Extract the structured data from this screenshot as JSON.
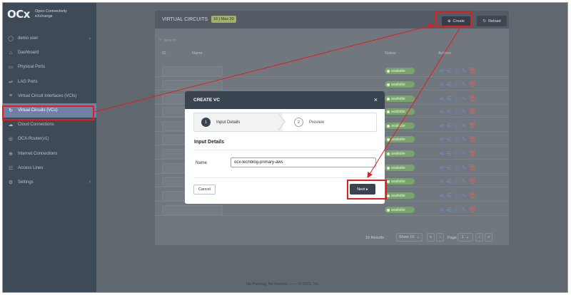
{
  "brand": {
    "logo": "OCx",
    "line1": "Open Connectivity",
    "line2": "eXchange"
  },
  "sidebar": {
    "items": [
      {
        "label": "demo user",
        "icon": "user-icon",
        "chevron": "›"
      },
      {
        "label": "Dashboard",
        "icon": "home-icon"
      },
      {
        "label": "Physical Ports",
        "icon": "port-icon"
      },
      {
        "label": "LAG Ports",
        "icon": "lag-icon"
      },
      {
        "label": "Virtual Circuit Interfaces (VCIs)",
        "icon": "sliders-icon"
      },
      {
        "label": "Virtual Circuits (VCs)",
        "icon": "circuit-icon"
      },
      {
        "label": "Cloud Connections",
        "icon": "cloud-icon"
      },
      {
        "label": "OCX-Router(v1)",
        "icon": "router-icon"
      },
      {
        "label": "Internet Connections",
        "icon": "globe-icon"
      },
      {
        "label": "Access Lines",
        "icon": "lines-icon"
      },
      {
        "label": "Settings",
        "icon": "gear-icon",
        "chevron": "›"
      }
    ]
  },
  "panel": {
    "title": "VIRTUAL CIRCUITS",
    "count_badge": "16 | Max 20",
    "create_label": "Create",
    "reload_label": "Reload",
    "search_placeholder": "Search",
    "columns": {
      "id": "ID",
      "name": "Name",
      "status": "Status",
      "actions": "Actions"
    },
    "row_status": "available",
    "results": "16 Results",
    "show_select": "Show 10",
    "page_label": "Page",
    "page_value": "1",
    "pager": {
      "first": "«",
      "prev": "‹",
      "next": "›",
      "last": "»"
    }
  },
  "modal": {
    "title": "CREATE VC",
    "close": "×",
    "steps": [
      {
        "num": "1",
        "label": "Input Details"
      },
      {
        "num": "2",
        "label": "Preview"
      }
    ],
    "section_title": "Input Details",
    "name_label": "Name",
    "name_value": "ocx-techblog-primary-aws",
    "cancel_label": "Cancel",
    "next_label": "Next ▸"
  },
  "footer_note": "No Peering, No Internet. —— © 2021, Inc.",
  "colors": {
    "highlight": "#e11d1d",
    "active_nav": "#6f80a5",
    "status_green": "#79a36d"
  }
}
